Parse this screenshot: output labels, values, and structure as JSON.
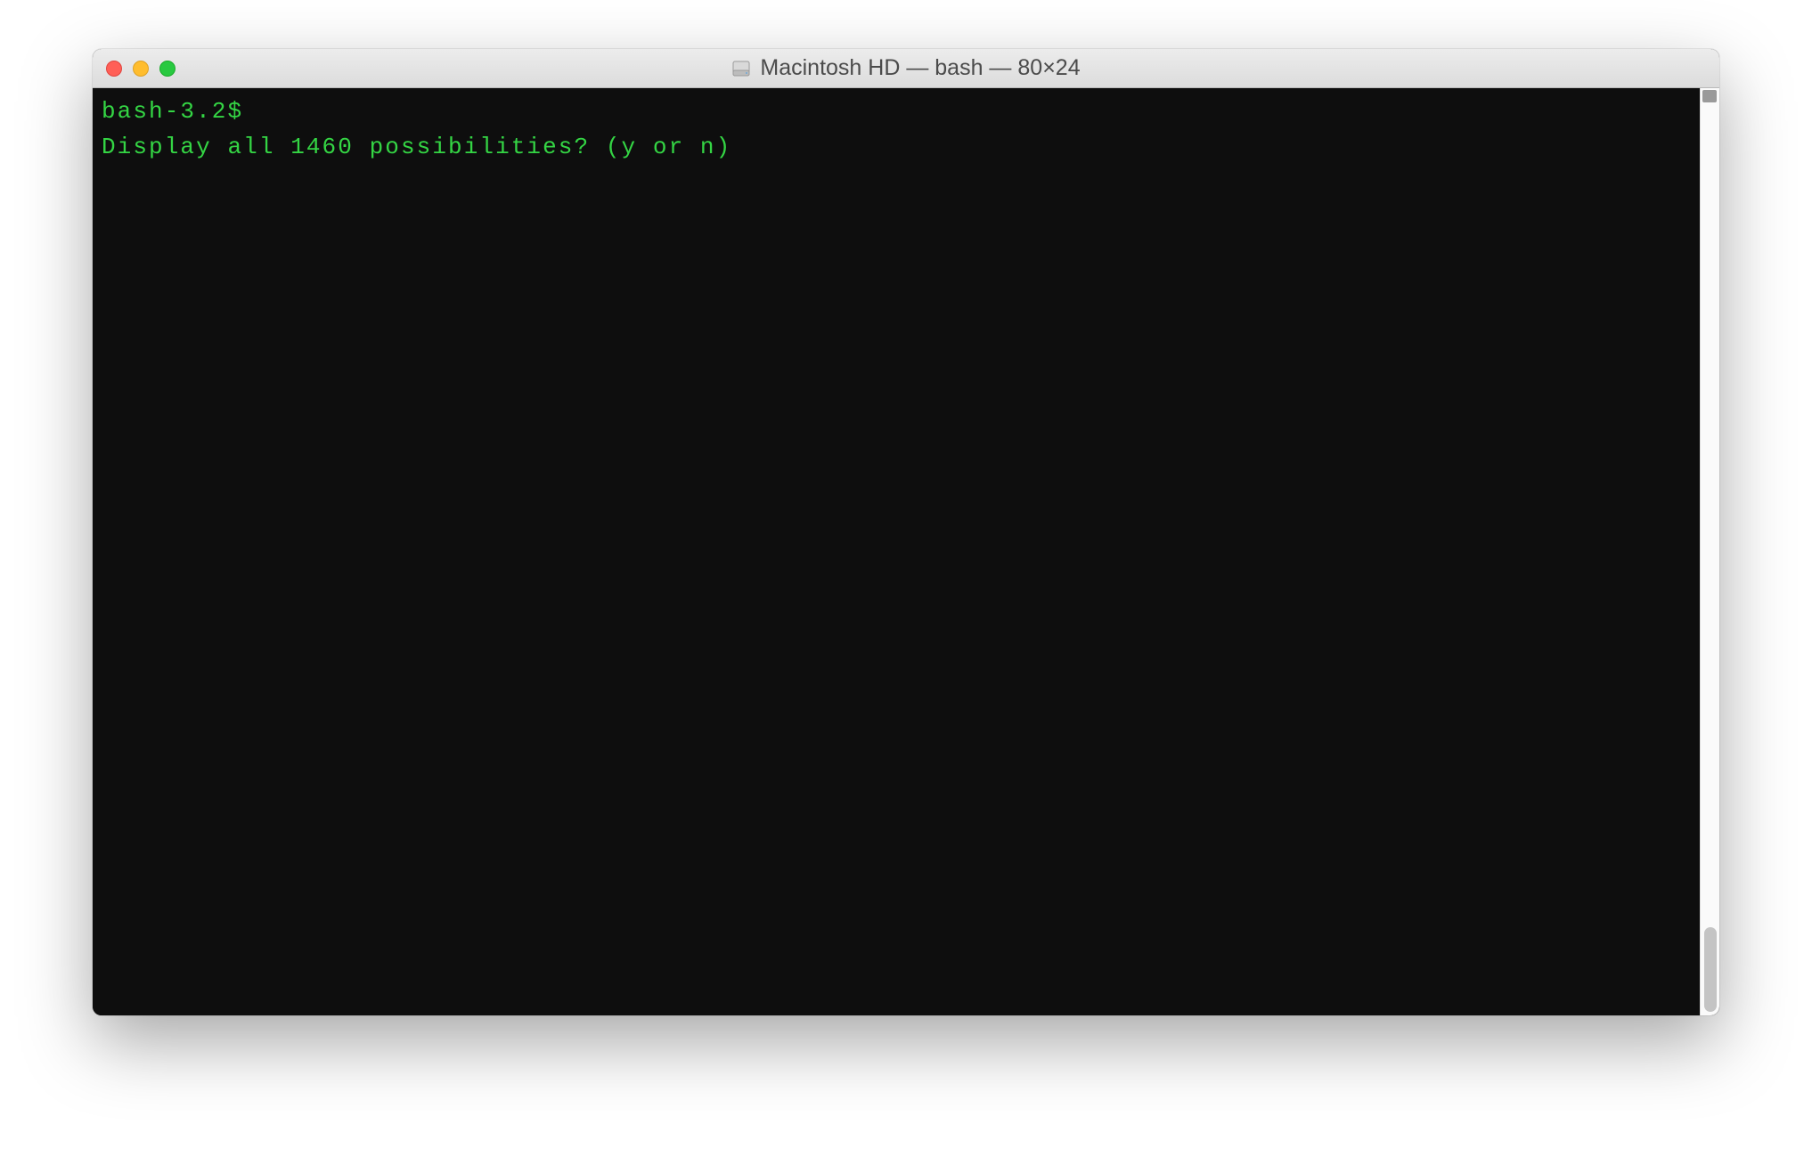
{
  "window": {
    "title": "Macintosh HD — bash — 80×24"
  },
  "terminal": {
    "prompt": "bash-3.2$ ",
    "line2": "Display all 1460 possibilities? (y or n)"
  }
}
